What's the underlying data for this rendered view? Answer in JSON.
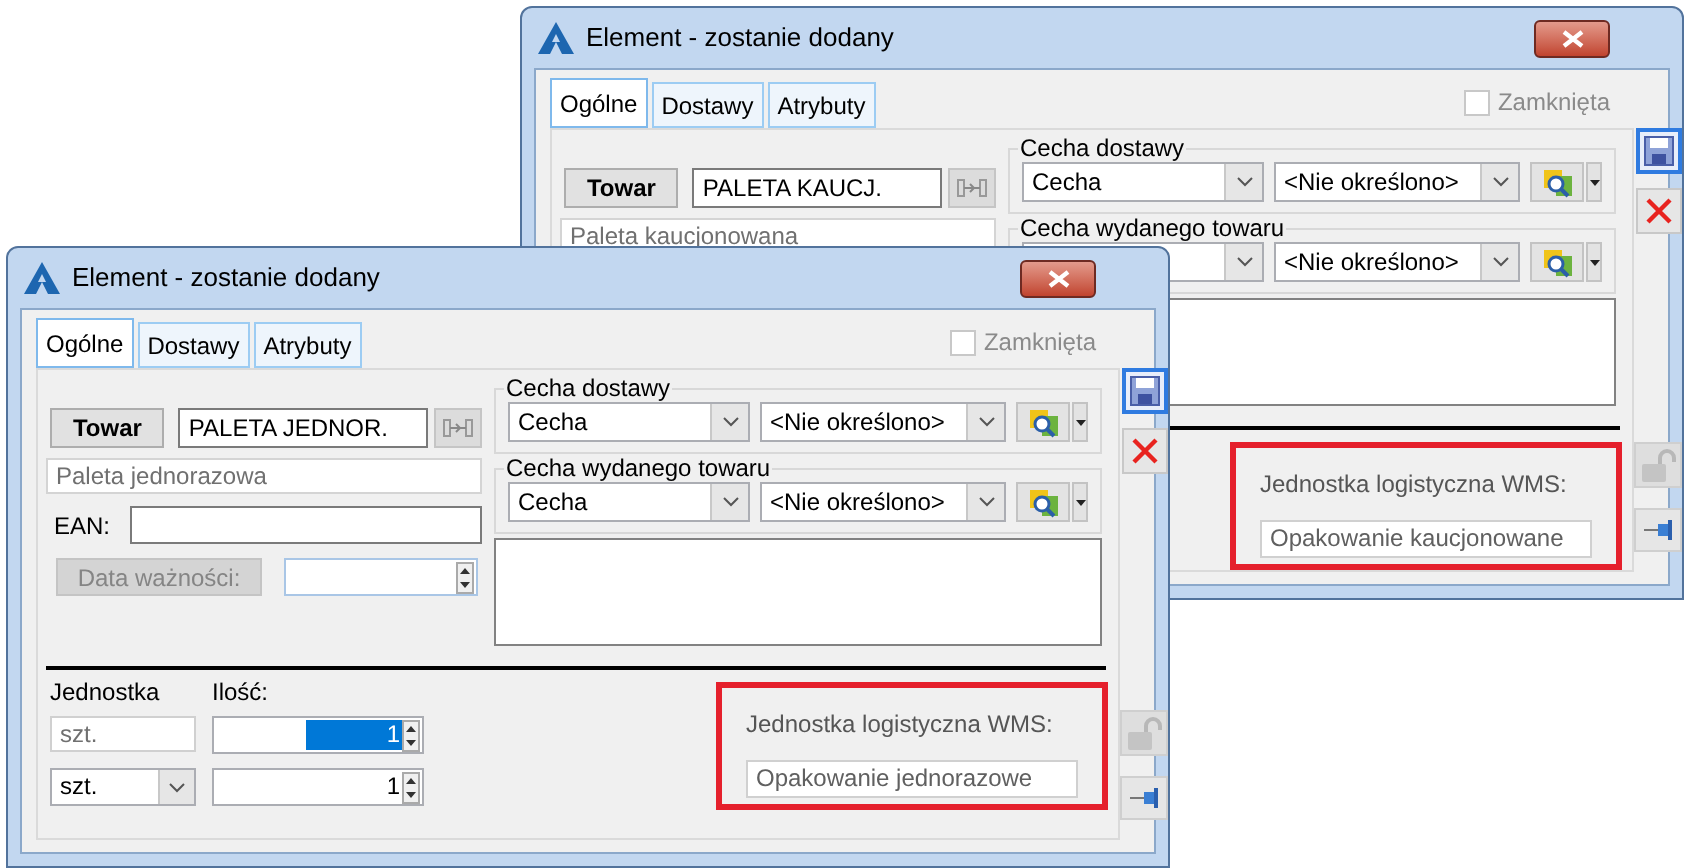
{
  "windows": [
    {
      "title": "Element - zostanie dodany",
      "tabs": [
        {
          "label": "Ogólne",
          "selected": true
        },
        {
          "label": "Dostawy",
          "selected": false
        },
        {
          "label": "Atrybuty",
          "selected": false
        }
      ],
      "closed_checkbox": {
        "label": "Zamknięta",
        "checked": false
      },
      "item_button": "Towar",
      "item_code": "PALETA KAUCJ.",
      "item_name": "Paleta kaucjonowana",
      "groups": [
        {
          "title": "Cecha dostawy",
          "attribute": "Cecha",
          "value": "<Nie określono>"
        },
        {
          "title": "Cecha wydanego towaru",
          "value": "<Nie określono>"
        }
      ],
      "wms": {
        "label": "Jednostka logistyczna WMS:",
        "value": "Opakowanie kaucjonowane"
      }
    },
    {
      "title": "Element - zostanie dodany",
      "tabs": [
        {
          "label": "Ogólne",
          "selected": true
        },
        {
          "label": "Dostawy",
          "selected": false
        },
        {
          "label": "Atrybuty",
          "selected": false
        }
      ],
      "closed_checkbox": {
        "label": "Zamknięta",
        "checked": false
      },
      "item_button": "Towar",
      "item_code": "PALETA JEDNOR.",
      "item_name": "Paleta jednorazowa",
      "ean": {
        "label": "EAN:"
      },
      "expiry_button": {
        "label": "Data ważności:",
        "disabled": true
      },
      "groups": [
        {
          "title": "Cecha dostawy",
          "attribute": "Cecha",
          "value": "<Nie określono>"
        },
        {
          "title": "Cecha wydanego towaru",
          "attribute": "Cecha",
          "value": "<Nie określono>"
        }
      ],
      "units": {
        "unit_label": "Jednostka",
        "quantity_label": "Ilość:",
        "rows": [
          {
            "kind": "readonly",
            "unit": "szt.",
            "quantity": "1",
            "selected": true
          },
          {
            "kind": "dropdown",
            "unit": "szt.",
            "quantity": "1",
            "selected": false
          }
        ]
      },
      "wms": {
        "label": "Jednostka logistyczna WMS:",
        "value": "Opakowanie jednorazowe"
      }
    }
  ]
}
